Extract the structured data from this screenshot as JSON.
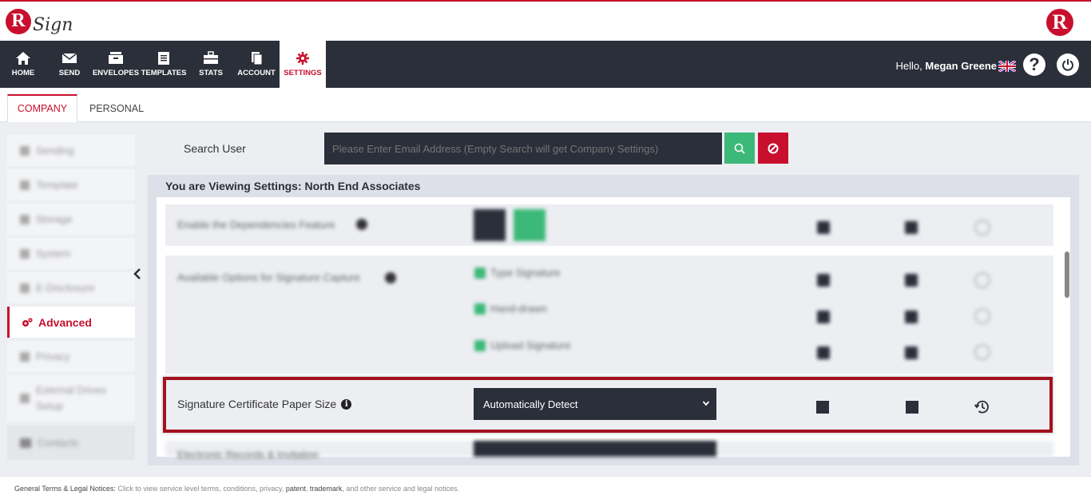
{
  "header": {
    "logo_letter": "R",
    "logo_text": "Sign",
    "right_logo_letter": "R"
  },
  "nav": {
    "items": [
      {
        "label": "HOME",
        "icon": "home-icon"
      },
      {
        "label": "SEND",
        "icon": "envelope-icon"
      },
      {
        "label": "ENVELOPES",
        "icon": "envelopes-icon"
      },
      {
        "label": "TEMPLATES",
        "icon": "templates-icon"
      },
      {
        "label": "STATS",
        "icon": "briefcase-icon"
      },
      {
        "label": "ACCOUNT",
        "icon": "account-icon"
      },
      {
        "label": "SETTINGS",
        "icon": "gear-icon",
        "active": true
      }
    ],
    "greeting": "Hello,",
    "user_name": "Megan Greene",
    "help_icon": "?"
  },
  "tabs": {
    "company": "COMPANY",
    "personal": "PERSONAL",
    "active": "COMPANY"
  },
  "sidebar": {
    "items": [
      {
        "label": "Sending",
        "blurred": true
      },
      {
        "label": "Template",
        "blurred": true
      },
      {
        "label": "Storage",
        "blurred": true
      },
      {
        "label": "System",
        "blurred": true
      },
      {
        "label": "E-Disclosure",
        "blurred": true
      },
      {
        "label": "Advanced",
        "active": true
      },
      {
        "label": "Privacy",
        "blurred": true
      },
      {
        "label": "External Drives Setup",
        "blurred": true
      },
      {
        "label": "Contacts",
        "blurred": true
      }
    ]
  },
  "search": {
    "label": "Search User",
    "placeholder": "Please Enter Email Address (Empty Search will get Company Settings)"
  },
  "panel": {
    "title": "You are Viewing Settings: North End Associates",
    "blurred_rows": [
      {
        "label": "Enable the Dependencies Feature"
      },
      {
        "label": "Available Options for Signature Capture",
        "options": [
          "Type Signature",
          "Hand-drawn",
          "Upload Signature"
        ]
      },
      {
        "label": "Electronic Records & Invitation"
      }
    ],
    "highlighted_row": {
      "label": "Signature Certificate Paper Size",
      "selected": "Automatically Detect"
    }
  },
  "footer": {
    "heading": "General Terms & Legal Notices:",
    "text_1": " Click to view service level terms, conditions, privacy, ",
    "link_patent": "patent",
    "sep": ", ",
    "link_trademark": "trademark",
    "text_2": ", and other service and legal notices."
  },
  "colors": {
    "brand_red": "#c8102e",
    "nav_dark": "#2b2f3a",
    "success_green": "#3cb878",
    "highlight_border": "#a3101f"
  }
}
